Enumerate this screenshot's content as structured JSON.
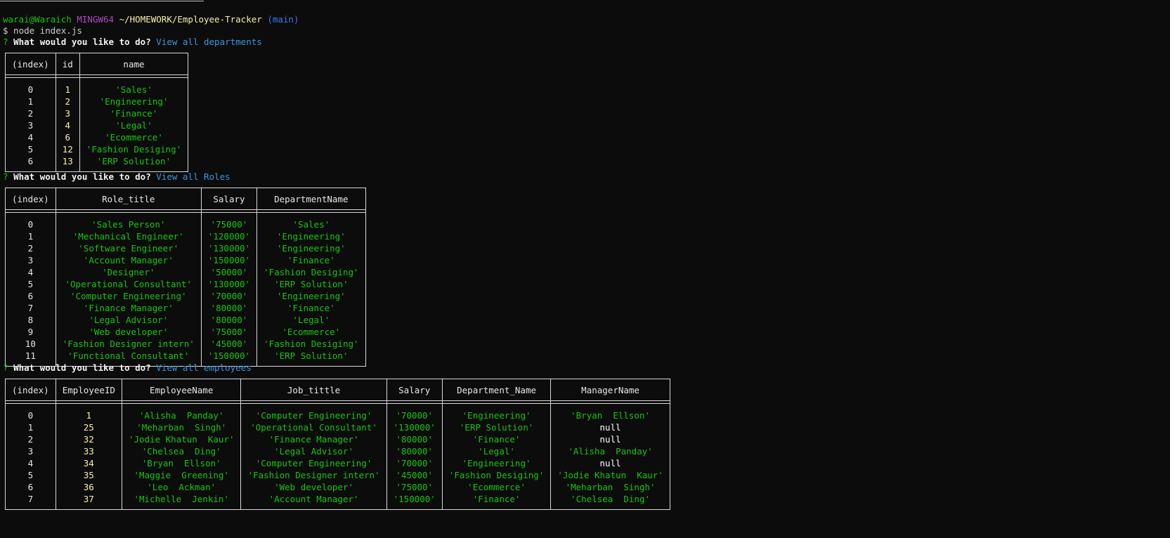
{
  "prompt": {
    "user_host": "warai@Waraich",
    "shell": "MINGW64",
    "path": "~/HOMEWORK/Employee-Tracker",
    "branch": "(main)",
    "command": "$ node index.js"
  },
  "questions": [
    {
      "mark": "?",
      "text": "What would you like to do?",
      "answer": "View all departments"
    },
    {
      "mark": "?",
      "text": "What would you like to do?",
      "answer": "View all Roles"
    },
    {
      "mark": "?",
      "text": "What would you like to do?",
      "answer": "View all employees"
    }
  ],
  "departments": {
    "headers": [
      "(index)",
      "id",
      "name"
    ],
    "rows": [
      [
        "0",
        "1",
        "'Sales'"
      ],
      [
        "1",
        "2",
        "'Engineering'"
      ],
      [
        "2",
        "3",
        "'Finance'"
      ],
      [
        "3",
        "4",
        "'Legal'"
      ],
      [
        "4",
        "6",
        "'Ecommerce'"
      ],
      [
        "5",
        "12",
        "'Fashion Desiging'"
      ],
      [
        "6",
        "13",
        "'ERP Solution'"
      ]
    ]
  },
  "roles": {
    "headers": [
      "(index)",
      "Role_title",
      "Salary",
      "DepartmentName"
    ],
    "rows": [
      [
        "0",
        "'Sales Person'",
        "'75000'",
        "'Sales'"
      ],
      [
        "1",
        "'Mechanical Engineer'",
        "'120000'",
        "'Engineering'"
      ],
      [
        "2",
        "'Software Engineer'",
        "'130000'",
        "'Engineering'"
      ],
      [
        "3",
        "'Account Manager'",
        "'150000'",
        "'Finance'"
      ],
      [
        "4",
        "'Designer'",
        "'50000'",
        "'Fashion Desiging'"
      ],
      [
        "5",
        "'Operational Consultant'",
        "'130000'",
        "'ERP Solution'"
      ],
      [
        "6",
        "'Computer Engineering'",
        "'70000'",
        "'Engineering'"
      ],
      [
        "7",
        "'Finance Manager'",
        "'80000'",
        "'Finance'"
      ],
      [
        "8",
        "'Legal Advisor'",
        "'80000'",
        "'Legal'"
      ],
      [
        "9",
        "'Web developer'",
        "'75000'",
        "'Ecommerce'"
      ],
      [
        "10",
        "'Fashion Designer intern'",
        "'45000'",
        "'Fashion Desiging'"
      ],
      [
        "11",
        "'Functional Consultant'",
        "'150000'",
        "'ERP Solution'"
      ]
    ]
  },
  "employees": {
    "headers": [
      "(index)",
      "EmployeeID",
      "EmployeeName",
      "Job_tittle",
      "Salary",
      "Department_Name",
      "ManagerName"
    ],
    "rows": [
      [
        "0",
        "1",
        "'Alisha  Panday'",
        "'Computer Engineering'",
        "'70000'",
        "'Engineering'",
        "'Bryan  Ellson'"
      ],
      [
        "1",
        "25",
        "'Meharban  Singh'",
        "'Operational Consultant'",
        "'130000'",
        "'ERP Solution'",
        "null"
      ],
      [
        "2",
        "32",
        "'Jodie Khatun  Kaur'",
        "'Finance Manager'",
        "'80000'",
        "'Finance'",
        "null"
      ],
      [
        "3",
        "33",
        "'Chelsea  Ding'",
        "'Legal Advisor'",
        "'80000'",
        "'Legal'",
        "'Alisha  Panday'"
      ],
      [
        "4",
        "34",
        "'Bryan  Ellson'",
        "'Computer Engineering'",
        "'70000'",
        "'Engineering'",
        "null"
      ],
      [
        "5",
        "35",
        "'Maggie  Greening'",
        "'Fashion Designer intern'",
        "'45000'",
        "'Fashion Desiging'",
        "'Jodie Khatun  Kaur'"
      ],
      [
        "6",
        "36",
        "'Leo  Ackman'",
        "'Web developer'",
        "'75000'",
        "'Ecommerce'",
        "'Meharban  Singh'"
      ],
      [
        "7",
        "37",
        "'Michelle  Jenkin'",
        "'Account Manager'",
        "'150000'",
        "'Finance'",
        "'Chelsea  Ding'"
      ]
    ]
  }
}
